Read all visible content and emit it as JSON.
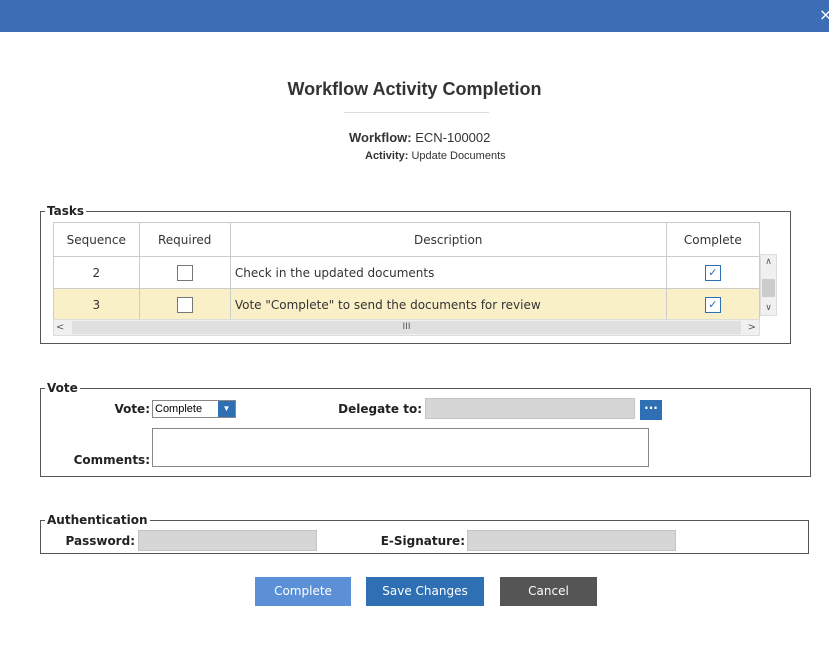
{
  "window": {
    "close_glyph": "×"
  },
  "title": "Workflow Activity Completion",
  "workflow": {
    "label": "Workflow:",
    "value": "ECN-100002"
  },
  "activity": {
    "label": "Activity:",
    "value": "Update Documents"
  },
  "tasks": {
    "legend": "Tasks",
    "columns": [
      "Sequence",
      "Required",
      "Description",
      "Complete"
    ],
    "rows": [
      {
        "sequence": "2",
        "required": false,
        "description": "Check in the updated documents",
        "complete": true
      },
      {
        "sequence": "3",
        "required": false,
        "description": "Vote \"Complete\" to send the documents for review",
        "complete": true,
        "selected": true
      }
    ],
    "hscroll_grip": "III"
  },
  "vote": {
    "legend": "Vote",
    "vote_label": "Vote:",
    "vote_value": "Complete",
    "delegate_label": "Delegate to:",
    "delegate_value": "",
    "browse_glyph": "···",
    "comments_label": "Comments:",
    "comments_value": ""
  },
  "auth": {
    "legend": "Authentication",
    "password_label": "Password:",
    "esig_label": "E-Signature:"
  },
  "buttons": {
    "complete": "Complete",
    "save": "Save Changes",
    "cancel": "Cancel"
  },
  "colors": {
    "titlebar": "#3d6db5",
    "complete_button": "#5b8fd6",
    "save_button": "#2f6fb4",
    "cancel_button": "#555555",
    "selected_row": "#faf0c8"
  }
}
